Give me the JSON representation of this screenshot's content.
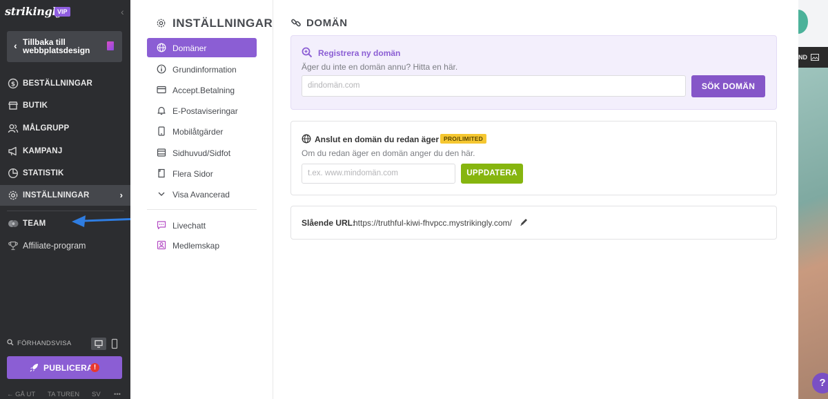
{
  "sidebar": {
    "logo": "strikingly",
    "vip": "VIP",
    "back_label": "Tillbaka till webbplatsdesign",
    "nav": [
      {
        "label": "BESTÄLLNINGAR",
        "icon": "dollar-circle-icon"
      },
      {
        "label": "BUTIK",
        "icon": "store-icon"
      },
      {
        "label": "MÅLGRUPP",
        "icon": "users-icon"
      },
      {
        "label": "KAMPANJ",
        "icon": "megaphone-icon"
      },
      {
        "label": "STATISTIK",
        "icon": "pie-chart-icon"
      },
      {
        "label": "INSTÄLLNINGAR",
        "icon": "gear-icon"
      }
    ],
    "team": "TEAM",
    "affiliate": "Affiliate-program",
    "preview": "FÖRHANDSVISA",
    "publish": "PUBLICERA",
    "bottom": {
      "exit": "GÅ UT",
      "tour": "TA TUREN",
      "lang": "SV",
      "more": "•••"
    }
  },
  "settings": {
    "title": "INSTÄLLNINGAR",
    "items": [
      {
        "label": "Domäner",
        "icon": "globe-icon"
      },
      {
        "label": "Grundinformation",
        "icon": "info-icon"
      },
      {
        "label": "Accept.Betalning",
        "icon": "credit-card-icon"
      },
      {
        "label": "E-Postaviseringar",
        "icon": "bell-icon"
      },
      {
        "label": "Mobilåtgärder",
        "icon": "mobile-icon"
      },
      {
        "label": "Sidhuvud/Sidfot",
        "icon": "layout-icon"
      },
      {
        "label": "Flera Sidor",
        "icon": "pages-icon"
      },
      {
        "label": "Visa Avancerad",
        "icon": "chevron-down-icon"
      },
      {
        "label": "Livechatt",
        "icon": "chat-icon"
      },
      {
        "label": "Medlemskap",
        "icon": "member-icon"
      }
    ]
  },
  "domain": {
    "title": "DOMÄN",
    "register": {
      "title": "Registrera ny domän",
      "subtitle": "Äger du inte en domän annu? Hitta en här.",
      "placeholder": "dindomän.com",
      "button": "SÖK DOMÄN"
    },
    "connect": {
      "title": "Anslut en domän du redan äger",
      "badge": "PRO/LIMITED",
      "subtitle": "Om du redan äger en domän anger du den här.",
      "placeholder": "t.ex. www.mindomän.com",
      "button": "UPPDATERA"
    },
    "url": {
      "label": "Slående URL:",
      "value": "https://truthful-kiwi-fhvpcc.mystrikingly.com/"
    }
  },
  "background": {
    "bar_text": "ND",
    "help": "?"
  },
  "colors": {
    "accent": "#8b5ed4",
    "update_green": "#86b50f",
    "sidebar_bg": "#2c2d30",
    "badge": "#f5c731",
    "annotation_arrow": "#2f7de1"
  }
}
